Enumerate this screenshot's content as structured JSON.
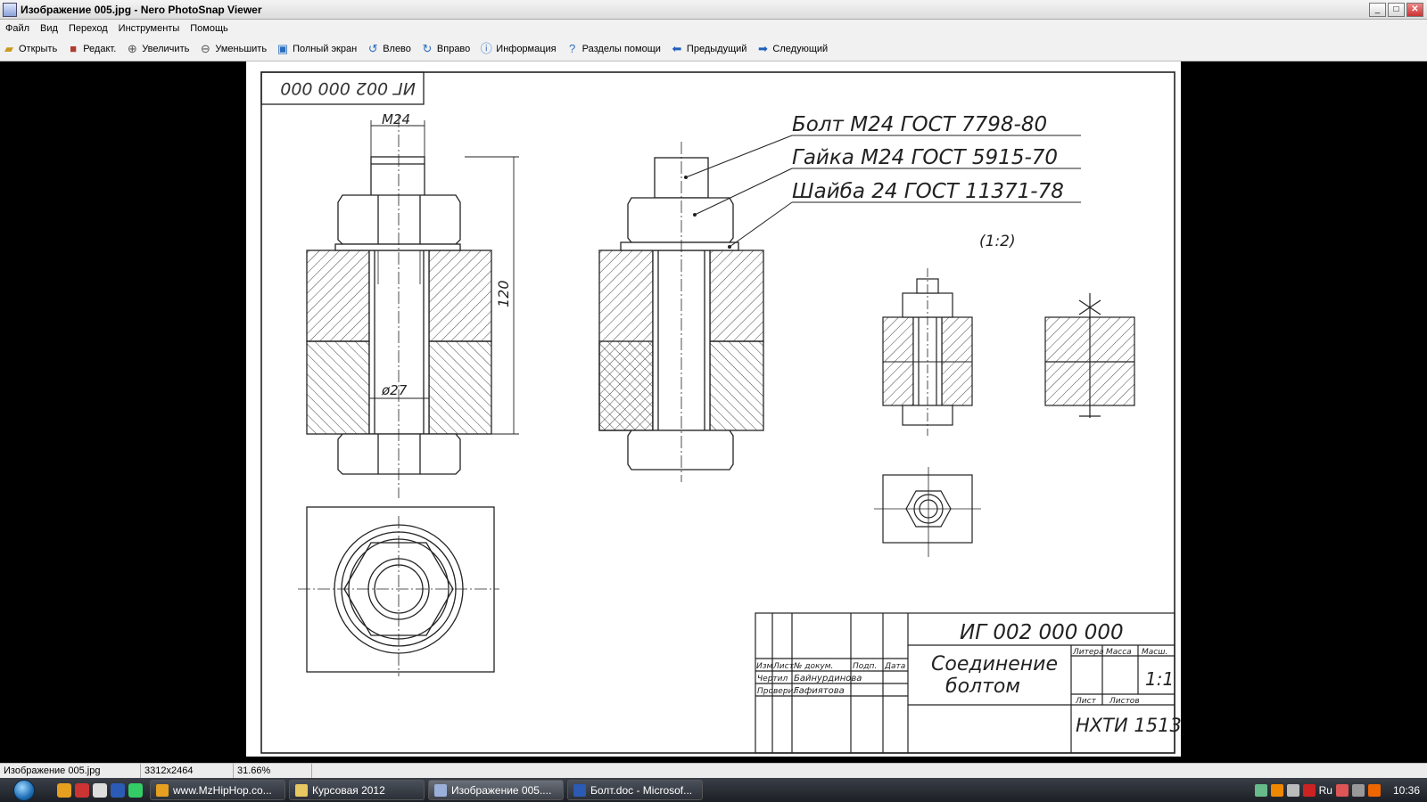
{
  "window": {
    "title": "Изображение 005.jpg - Nero PhotoSnap Viewer",
    "controls": [
      "_",
      "□",
      "✕"
    ]
  },
  "menu": [
    "Файл",
    "Вид",
    "Переход",
    "Инструменты",
    "Помощь"
  ],
  "toolbar": [
    {
      "label": "Открыть",
      "icon": "folder-open-icon"
    },
    {
      "label": "Редакт.",
      "icon": "edit-icon"
    },
    {
      "label": "Увеличить",
      "icon": "zoom-in-icon"
    },
    {
      "label": "Уменьшить",
      "icon": "zoom-out-icon"
    },
    {
      "label": "Полный экран",
      "icon": "fullscreen-icon"
    },
    {
      "label": "Влево",
      "icon": "rotate-left-icon"
    },
    {
      "label": "Вправо",
      "icon": "rotate-right-icon"
    },
    {
      "label": "Информация",
      "icon": "info-icon"
    },
    {
      "label": "Разделы помощи",
      "icon": "help-icon"
    },
    {
      "label": "Предыдущий",
      "icon": "arrow-left-icon"
    },
    {
      "label": "Следующий",
      "icon": "arrow-right-icon"
    }
  ],
  "drawing": {
    "stamp_code": "ИГ 002 000 000",
    "dim_m24": "М24",
    "dim_120": "120",
    "dim_d27": "ø27",
    "callout_bolt": "Болт М24 ГОСТ 7798-80",
    "callout_nut": "Гайка М24 ГОСТ 5915-70",
    "callout_washer": "Шайба 24 ГОСТ 11371-78",
    "scale_note": "(1:2)",
    "titleblock": {
      "code": "ИГ 002 000 000",
      "name_line1": "Соединение",
      "name_line2": "болтом",
      "col_headers": [
        "Изм",
        "Лист",
        "№ докум.",
        "Подп.",
        "Дата"
      ],
      "row_drawn": "Чертил",
      "row_checked": "Проверил",
      "drawn_by": "Байнурдинова",
      "checked_by": "Гафиятова",
      "litera": "Литера",
      "mass": "Масса",
      "scale_label": "Масш.",
      "scale": "1:1",
      "sheet": "Лист",
      "sheets": "Листов",
      "org": "НХТИ 1513"
    }
  },
  "status": {
    "filename": "Изображение 005.jpg",
    "dimensions": "3312x2464",
    "zoom": "31.66%"
  },
  "taskbar": {
    "items": [
      {
        "label": "www.MzHipHop.co...",
        "color": "#e6a020"
      },
      {
        "label": "Курсовая 2012",
        "color": "#e8c860"
      },
      {
        "label": "Изображение 005....",
        "color": "#9ab0d8",
        "active": true
      },
      {
        "label": "Болт.doc - Microsof...",
        "color": "#2b5bb5"
      }
    ],
    "lang": "Ru",
    "clock": "10:36"
  }
}
